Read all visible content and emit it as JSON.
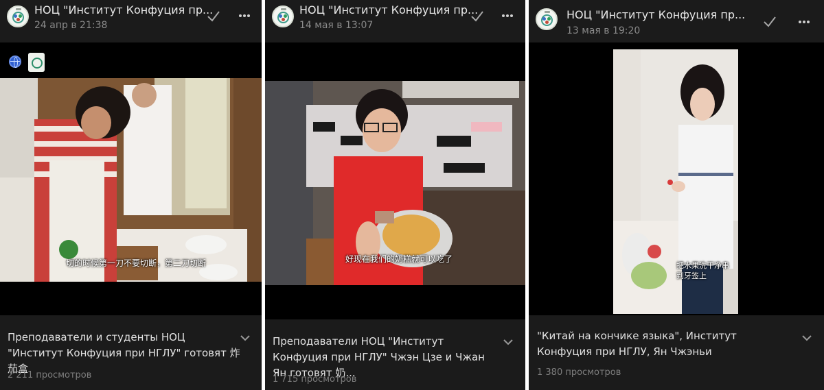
{
  "posts": [
    {
      "author": "НОЦ \"Институт Конфуция пр...",
      "date": "24 апр в 21:38",
      "subtitle": "切的时候第一刀不要切断，第二刀切断",
      "caption": "Преподаватели и студенты НОЦ \"Институт Конфуция при НГЛУ\" готовят 炸茄盒",
      "views": "2 211 просмотров"
    },
    {
      "author": "НОЦ \"Институт Конфуция пр...",
      "date": "14 мая в 13:07",
      "subtitle": "好现在我们的奶糕就可以吃了",
      "caption": "Преподаватели НОЦ \"Институт Конфуция при НГЛУ\" Чжэн Цзе и Чжан Ян готовят 奶...",
      "views": "1 715 просмотров"
    },
    {
      "author": "НОЦ \"Институт Конфуция пр...",
      "date": "13 мая в 19:20",
      "subtitle": "把水果洗干净串到牙签上",
      "caption": "\"Китай на кончике языка\", Институт Конфуция при НГЛУ, Ян Чжэньи",
      "views": "1 380 просмотров"
    }
  ],
  "colors": {
    "panel_bg": "#1b1b1b",
    "text_primary": "#e9e9e9",
    "text_secondary": "#8a8a8a"
  },
  "icons": [
    "avatar",
    "checkmark-icon",
    "more-icon",
    "globe-icon",
    "logo-icon",
    "chevron-down-icon"
  ]
}
